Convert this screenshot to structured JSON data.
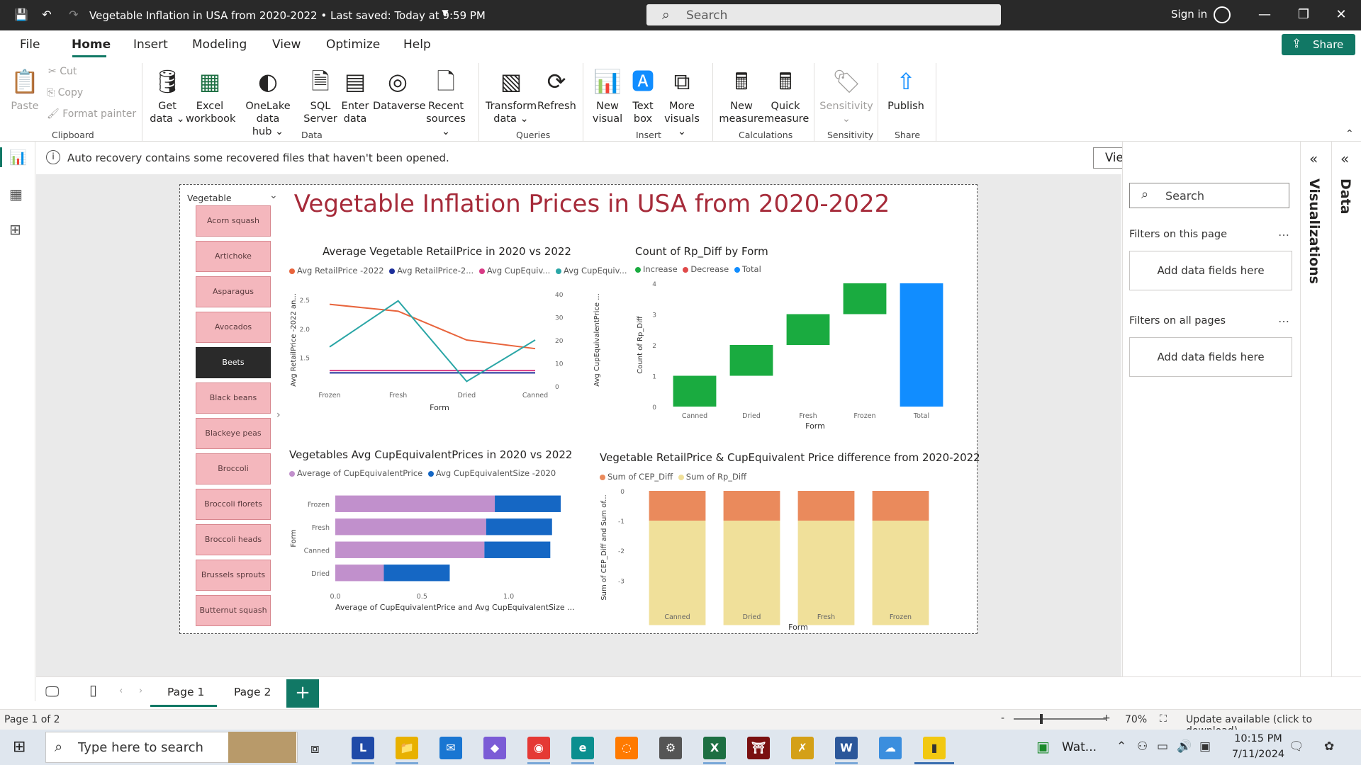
{
  "app": {
    "doc_title": "Vegetable Inflation in USA from 2020-2022 • Last saved: Today at 9:59 PM",
    "search_placeholder": "Search",
    "sign_in": "Sign in",
    "share": "Share"
  },
  "menu": {
    "tabs": [
      "File",
      "Home",
      "Insert",
      "Modeling",
      "View",
      "Optimize",
      "Help"
    ],
    "active": "Home"
  },
  "ribbon": {
    "clipboard": {
      "paste": "Paste",
      "cut": "Cut",
      "copy": "Copy",
      "format_painter": "Format painter",
      "group": "Clipboard"
    },
    "data": {
      "group": "Data",
      "get_data": [
        "Get",
        "data ⌄"
      ],
      "excel": [
        "Excel",
        "workbook"
      ],
      "onelake": [
        "OneLake data",
        "hub ⌄"
      ],
      "sql": [
        "SQL",
        "Server"
      ],
      "enter": [
        "Enter",
        "data"
      ],
      "dataverse": [
        "Dataverse"
      ],
      "recent": [
        "Recent",
        "sources ⌄"
      ]
    },
    "queries": {
      "group": "Queries",
      "transform": [
        "Transform",
        "data ⌄"
      ],
      "refresh": [
        "Refresh"
      ]
    },
    "insert": {
      "group": "Insert",
      "new_visual": [
        "New",
        "visual"
      ],
      "text_box": [
        "Text",
        "box"
      ],
      "more_visuals": [
        "More",
        "visuals ⌄"
      ]
    },
    "calculations": {
      "group": "Calculations",
      "new_measure": [
        "New",
        "measure"
      ],
      "quick_measure": [
        "Quick",
        "measure"
      ]
    },
    "sensitivity": {
      "group": "Sensitivity",
      "label": [
        "Sensitivity",
        "⌄"
      ]
    },
    "share": {
      "group": "Share",
      "publish": [
        "Publish"
      ]
    }
  },
  "infobar": {
    "message": "Auto recovery contains some recovered files that haven't been opened.",
    "button": "View recovered files"
  },
  "report": {
    "title": "Vegetable Inflation Prices in USA from 2020-2022",
    "slicer": {
      "title": "Vegetable",
      "items": [
        "Acorn squash",
        "Artichoke",
        "Asparagus",
        "Avocados",
        "Beets",
        "Black beans",
        "Blackeye peas",
        "Broccoli",
        "Broccoli florets",
        "Broccoli heads",
        "Brussels sprouts",
        "Butternut squash"
      ],
      "selected": "Beets"
    }
  },
  "chart_data": [
    {
      "type": "line",
      "title": "Average Vegetable RetailPrice in 2020 vs 2022",
      "legend": [
        "Avg RetailPrice -2022",
        "Avg RetailPrice-2...",
        "Avg CupEquiv...",
        "Avg CupEquiv..."
      ],
      "colors": [
        "#e8643c",
        "#1d2f9a",
        "#d83b86",
        "#2aa6a6"
      ],
      "categories": [
        "Frozen",
        "Fresh",
        "Dried",
        "Canned"
      ],
      "xlabel": "Form",
      "ylabel_left": "Avg RetailPrice -2022 an...",
      "ylabel_right": "Avg CupEquivalentPrice ...",
      "yticks_left": [
        "2.5",
        "2.0",
        "1.5"
      ],
      "yticks_right": [
        "40",
        "30",
        "20",
        "10",
        "0"
      ],
      "ylim_left": [
        1.0,
        2.6
      ],
      "ylim_right": [
        0,
        40
      ],
      "series": [
        {
          "name": "Avg RetailPrice -2022",
          "axis": "left",
          "values": [
            2.42,
            2.3,
            1.8,
            1.65
          ]
        },
        {
          "name": "Avg RetailPrice-2...",
          "axis": "left",
          "values": [
            1.23,
            1.23,
            1.23,
            1.23
          ]
        },
        {
          "name": "Avg CupEquiv...",
          "axis": "left",
          "values": [
            1.27,
            1.27,
            1.27,
            1.27
          ]
        },
        {
          "name": "Avg CupEquiv...",
          "axis": "right",
          "values": [
            17,
            37,
            2,
            20
          ]
        }
      ]
    },
    {
      "type": "bar",
      "subtype": "waterfall",
      "title": "Count of Rp_Diff by Form",
      "legend": [
        "Increase",
        "Decrease",
        "Total"
      ],
      "colors": {
        "increase": "#1aab40",
        "decrease": "#e04a4a",
        "total": "#118dff"
      },
      "categories": [
        "Canned",
        "Dried",
        "Fresh",
        "Frozen",
        "Total"
      ],
      "values": [
        1,
        1,
        1,
        1,
        4
      ],
      "xlabel": "Form",
      "ylabel": "Count of Rp_Diff",
      "yticks": [
        "4",
        "3",
        "2",
        "1",
        "0"
      ],
      "ylim": [
        0,
        4
      ]
    },
    {
      "type": "bar",
      "subtype": "stacked-horizontal",
      "title": "Vegetables Avg CupEquivalentPrices in 2020 vs 2022",
      "legend": [
        "Average of CupEquivalentPrice",
        "Avg CupEquivalentSize -2020"
      ],
      "colors": [
        "#c190cc",
        "#1567c4"
      ],
      "categories": [
        "Frozen",
        "Fresh",
        "Canned",
        "Dried"
      ],
      "series": [
        {
          "name": "Average of CupEquivalentPrice",
          "values": [
            0.92,
            0.87,
            0.86,
            0.28
          ]
        },
        {
          "name": "Avg CupEquivalentSize -2020",
          "values": [
            0.38,
            0.38,
            0.38,
            0.38
          ]
        }
      ],
      "xlabel": "Average of CupEquivalentPrice and Avg CupEquivalentSize ...",
      "ylabel": "Form",
      "xticks": [
        "0.0",
        "0.5",
        "1.0"
      ],
      "xlim": [
        0,
        1.3
      ]
    },
    {
      "type": "bar",
      "subtype": "stacked",
      "title": "Vegetable RetailPrice & CupEquivalent Price difference from 2020-2022",
      "legend": [
        "Sum of CEP_Diff",
        "Sum of Rp_Diff"
      ],
      "colors": [
        "#ea8a5c",
        "#f0e09a"
      ],
      "categories": [
        "Canned",
        "Dried",
        "Fresh",
        "Frozen"
      ],
      "series": [
        {
          "name": "Sum of CEP_Diff",
          "values": [
            -1,
            -1,
            -1,
            -1
          ]
        },
        {
          "name": "Sum of Rp_Diff",
          "values": [
            -3.5,
            -3.5,
            -3.5,
            -3.5
          ]
        }
      ],
      "xlabel": "Form",
      "ylabel": "Sum of CEP_Diff and Sum of...",
      "yticks": [
        "0",
        "-1",
        "-2",
        "-3"
      ],
      "ylim": [
        -3.8,
        0
      ]
    }
  ],
  "filters": {
    "search_placeholder": "Search",
    "this_page": "Filters on this page",
    "all_pages": "Filters on all pages",
    "add_fields": "Add data fields here",
    "dots": "…"
  },
  "panes": {
    "visualizations": "Visualizations",
    "data": "Data"
  },
  "pages": {
    "tabs": [
      "Page 1",
      "Page 2"
    ],
    "add": "+"
  },
  "status": {
    "page": "Page 1 of 2",
    "zoom_minus": "-",
    "zoom_plus": "+",
    "zoom": "70%",
    "update": "Update available (click to download)"
  },
  "taskbar": {
    "search": "Type here to search",
    "weather": "Wat...",
    "time": "10:15 PM",
    "date": "7/11/2024"
  }
}
